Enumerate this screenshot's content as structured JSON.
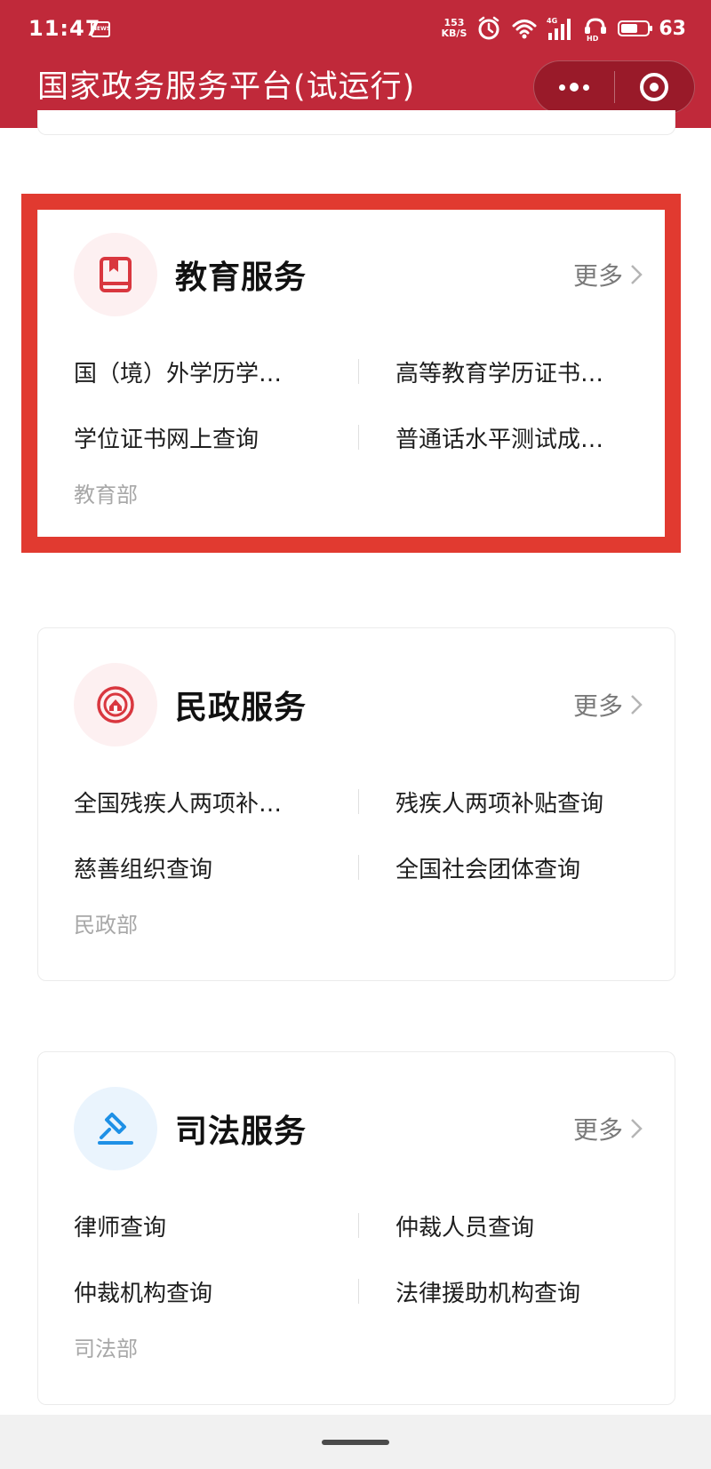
{
  "status_bar": {
    "time": "11:47",
    "news_badge": "NEWS",
    "net_speed_value": "153",
    "net_speed_unit": "KB/S",
    "battery_level": 63,
    "battery_text": "63"
  },
  "app": {
    "title": "国家政务服务平台(试运行)"
  },
  "colors": {
    "header_red": "#c0293a",
    "highlight_red": "#e13a30",
    "edu_icon": "#d9373f",
    "civil_icon": "#d9373f",
    "justice_icon": "#1e90e6"
  },
  "cards": [
    {
      "icon": "book-icon",
      "title": "教育服务",
      "more": "更多",
      "items": [
        "国（境）外学历学…",
        "高等教育学历证书…",
        "学位证书网上查询",
        "普通话水平测试成…"
      ],
      "department": "教育部"
    },
    {
      "icon": "civil-affairs-emblem-icon",
      "title": "民政服务",
      "more": "更多",
      "items": [
        "全国残疾人两项补…",
        "残疾人两项补贴查询",
        "慈善组织查询",
        "全国社会团体查询"
      ],
      "department": "民政部"
    },
    {
      "icon": "gavel-icon",
      "title": "司法服务",
      "more": "更多",
      "items": [
        "律师查询",
        "仲裁人员查询",
        "仲裁机构查询",
        "法律援助机构查询"
      ],
      "department": "司法部"
    }
  ]
}
